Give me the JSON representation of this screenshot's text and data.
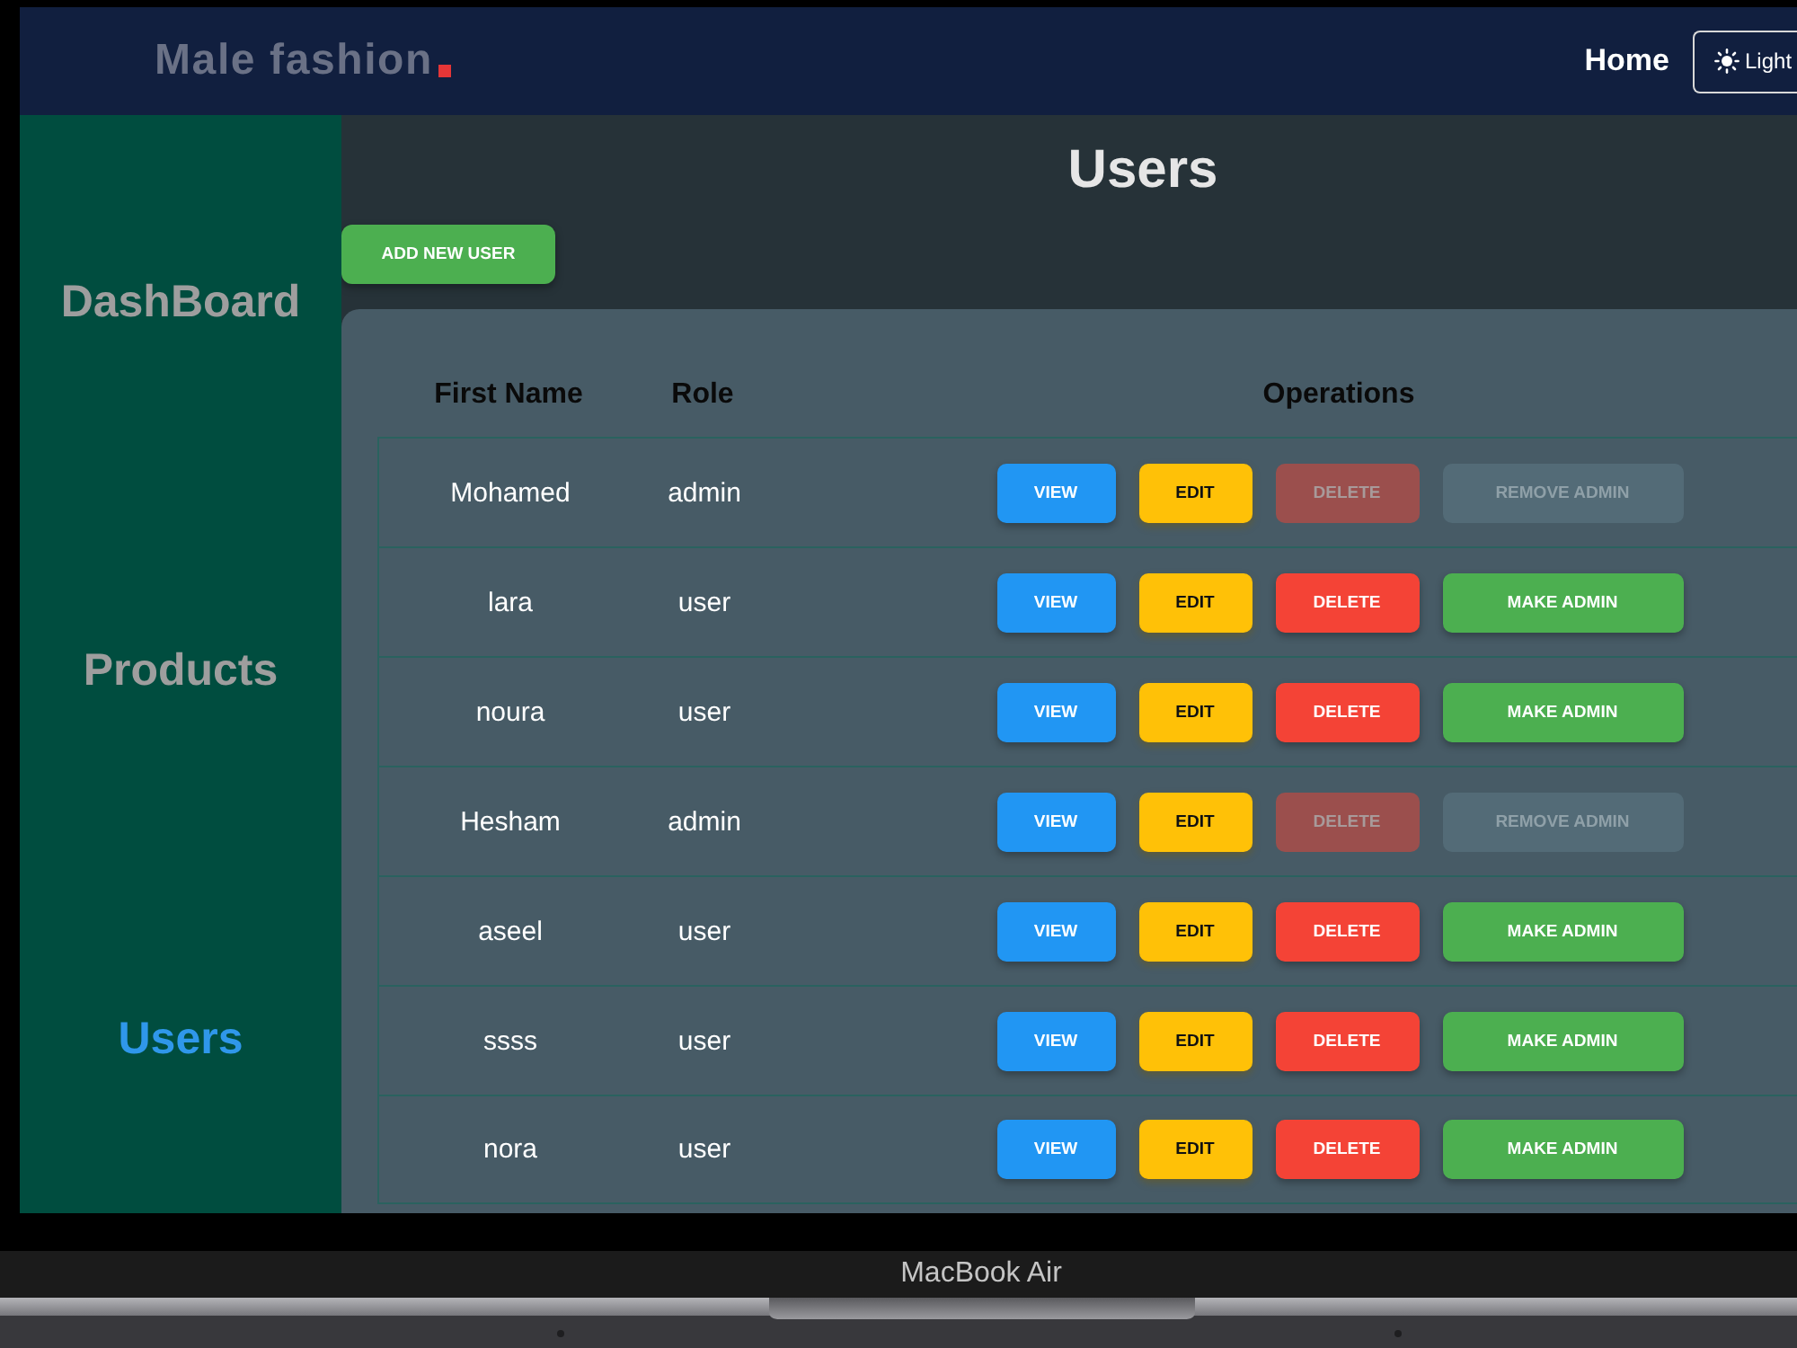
{
  "navbar": {
    "logo": "Male fashion",
    "links": [
      {
        "label": "Home"
      }
    ],
    "theme_button": {
      "label": "Light"
    }
  },
  "sidebar": {
    "items": [
      {
        "label": "DashBoard",
        "selected": false
      },
      {
        "label": "Products",
        "selected": false
      },
      {
        "label": "Users",
        "selected": true
      }
    ]
  },
  "page": {
    "title": "Users",
    "add_button": "ADD NEW USER"
  },
  "table": {
    "columns": [
      "First Name",
      "Role",
      "Operations"
    ],
    "rows": [
      {
        "first_name": "Mohamed",
        "role": "admin",
        "actions": [
          {
            "kind": "view",
            "label": "VIEW",
            "disabled": false
          },
          {
            "kind": "edit",
            "label": "EDIT",
            "disabled": false
          },
          {
            "kind": "delete",
            "label": "DELETE",
            "disabled": true
          },
          {
            "kind": "admin",
            "label": "REMOVE ADMIN",
            "disabled": true
          }
        ]
      },
      {
        "first_name": "lara",
        "role": "user",
        "actions": [
          {
            "kind": "view",
            "label": "VIEW",
            "disabled": false
          },
          {
            "kind": "edit",
            "label": "EDIT",
            "disabled": false
          },
          {
            "kind": "delete",
            "label": "DELETE",
            "disabled": false
          },
          {
            "kind": "admin",
            "label": "MAKE ADMIN",
            "disabled": false
          }
        ]
      },
      {
        "first_name": "noura",
        "role": "user",
        "actions": [
          {
            "kind": "view",
            "label": "VIEW",
            "disabled": false
          },
          {
            "kind": "edit",
            "label": "EDIT",
            "disabled": false
          },
          {
            "kind": "delete",
            "label": "DELETE",
            "disabled": false
          },
          {
            "kind": "admin",
            "label": "MAKE ADMIN",
            "disabled": false
          }
        ]
      },
      {
        "first_name": "Hesham",
        "role": "admin",
        "actions": [
          {
            "kind": "view",
            "label": "VIEW",
            "disabled": false
          },
          {
            "kind": "edit",
            "label": "EDIT",
            "disabled": false
          },
          {
            "kind": "delete",
            "label": "DELETE",
            "disabled": true
          },
          {
            "kind": "admin",
            "label": "REMOVE ADMIN",
            "disabled": true
          }
        ]
      },
      {
        "first_name": "aseel",
        "role": "user",
        "actions": [
          {
            "kind": "view",
            "label": "VIEW",
            "disabled": false
          },
          {
            "kind": "edit",
            "label": "EDIT",
            "disabled": false
          },
          {
            "kind": "delete",
            "label": "DELETE",
            "disabled": false
          },
          {
            "kind": "admin",
            "label": "MAKE ADMIN",
            "disabled": false
          }
        ]
      },
      {
        "first_name": "ssss",
        "role": "user",
        "actions": [
          {
            "kind": "view",
            "label": "VIEW",
            "disabled": false
          },
          {
            "kind": "edit",
            "label": "EDIT",
            "disabled": false
          },
          {
            "kind": "delete",
            "label": "DELETE",
            "disabled": false
          },
          {
            "kind": "admin",
            "label": "MAKE ADMIN",
            "disabled": false
          }
        ]
      },
      {
        "first_name": "nora",
        "role": "user",
        "actions": [
          {
            "kind": "view",
            "label": "VIEW",
            "disabled": false
          },
          {
            "kind": "edit",
            "label": "EDIT",
            "disabled": false
          },
          {
            "kind": "delete",
            "label": "DELETE",
            "disabled": false
          },
          {
            "kind": "admin",
            "label": "MAKE ADMIN",
            "disabled": false
          }
        ]
      }
    ]
  },
  "device": {
    "label": "MacBook Air"
  }
}
